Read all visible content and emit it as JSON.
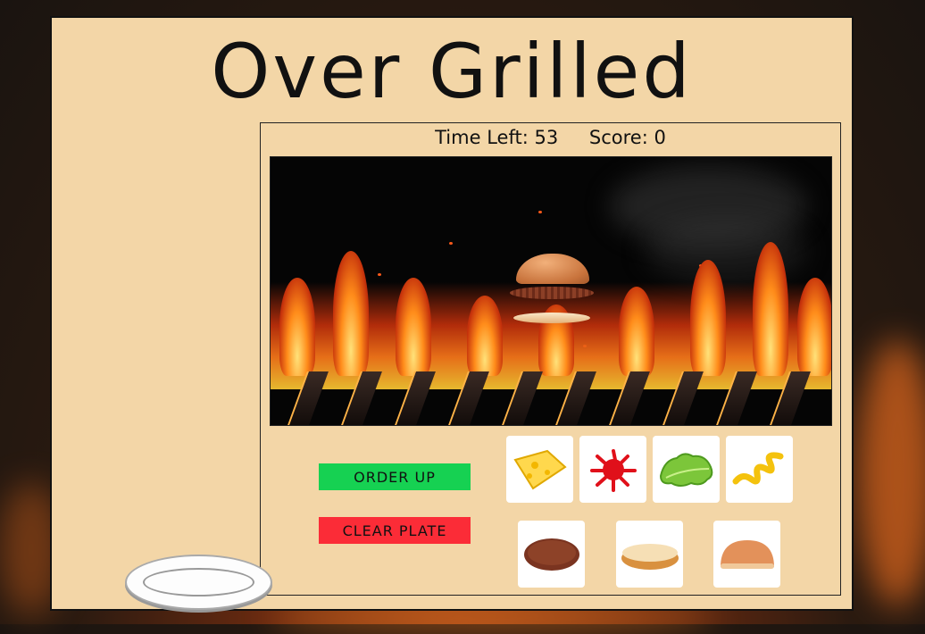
{
  "game": {
    "title": "Over Grilled",
    "hud": {
      "time_label": "Time Left:",
      "time_value": "53",
      "score_label": "Score:",
      "score_value": "0"
    },
    "buttons": {
      "order_up": "ORDER UP",
      "clear_plate": "CLEAR PLATE"
    },
    "toppings": [
      {
        "name": "cheese",
        "icon": "cheese-icon"
      },
      {
        "name": "ketchup",
        "icon": "ketchup-icon"
      },
      {
        "name": "lettuce",
        "icon": "lettuce-icon"
      },
      {
        "name": "mustard",
        "icon": "mustard-icon"
      }
    ],
    "base_items": [
      {
        "name": "patty",
        "icon": "patty-icon"
      },
      {
        "name": "bottom-bun",
        "icon": "bottom-bun-icon"
      },
      {
        "name": "top-bun",
        "icon": "top-bun-icon"
      }
    ],
    "colors": {
      "panel": "#f3d6a7",
      "order_button": "#16d152",
      "clear_button": "#fb2c37"
    }
  }
}
